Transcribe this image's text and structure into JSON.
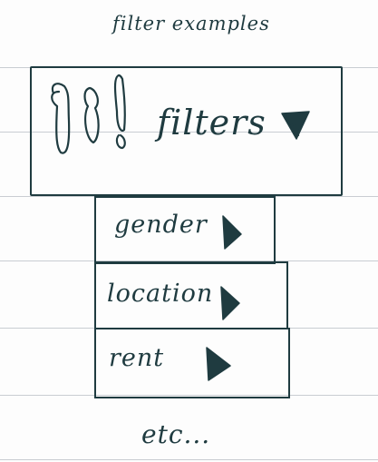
{
  "title": "filter examples",
  "filter_bar": {
    "label": "filters",
    "icon": "rainbow-logo-icon",
    "dropdown_icon": "triangle-down-icon"
  },
  "options": [
    {
      "label": "gender",
      "icon": "triangle-right-icon"
    },
    {
      "label": "location",
      "icon": "triangle-right-icon"
    },
    {
      "label": "rent",
      "icon": "triangle-right-icon"
    }
  ],
  "footer": "etc..."
}
